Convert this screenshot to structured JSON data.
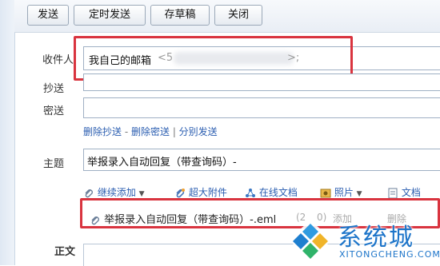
{
  "toolbar": {
    "send": "发送",
    "scheduled_send": "定时发送",
    "save_draft": "存草稿",
    "close": "关闭"
  },
  "recipient": {
    "label": "收件人",
    "name": "我自己的邮箱",
    "address_prefix": "<5",
    "address_suffix": ">;"
  },
  "cc": {
    "label": "抄送"
  },
  "bcc": {
    "label": "密送"
  },
  "cc_links": {
    "delete_cc": "删除抄送",
    "dash": " - ",
    "delete_bcc": "删除密送",
    "pipe": " | ",
    "separate_send": "分别发送"
  },
  "subject": {
    "label": "主题",
    "value": "举报录入自动回复（带查询码）-"
  },
  "attach_toolbar": {
    "continue_add": "继续添加",
    "large_attachment": "超大附件",
    "online_doc": "在线文档",
    "photo": "照片",
    "document": "文档"
  },
  "attachment": {
    "filename": "举报录入自动回复（带查询码）-.eml",
    "size": "(2",
    "size_end": "0)",
    "add_action": "添加",
    "delete_action": "删除"
  },
  "body": {
    "label": "正文"
  },
  "watermark": {
    "brand": "系统城",
    "domain": "XITONGCHENG.COM"
  },
  "colors": {
    "highlight_box": "#d9343f",
    "link": "#2a5db0"
  }
}
